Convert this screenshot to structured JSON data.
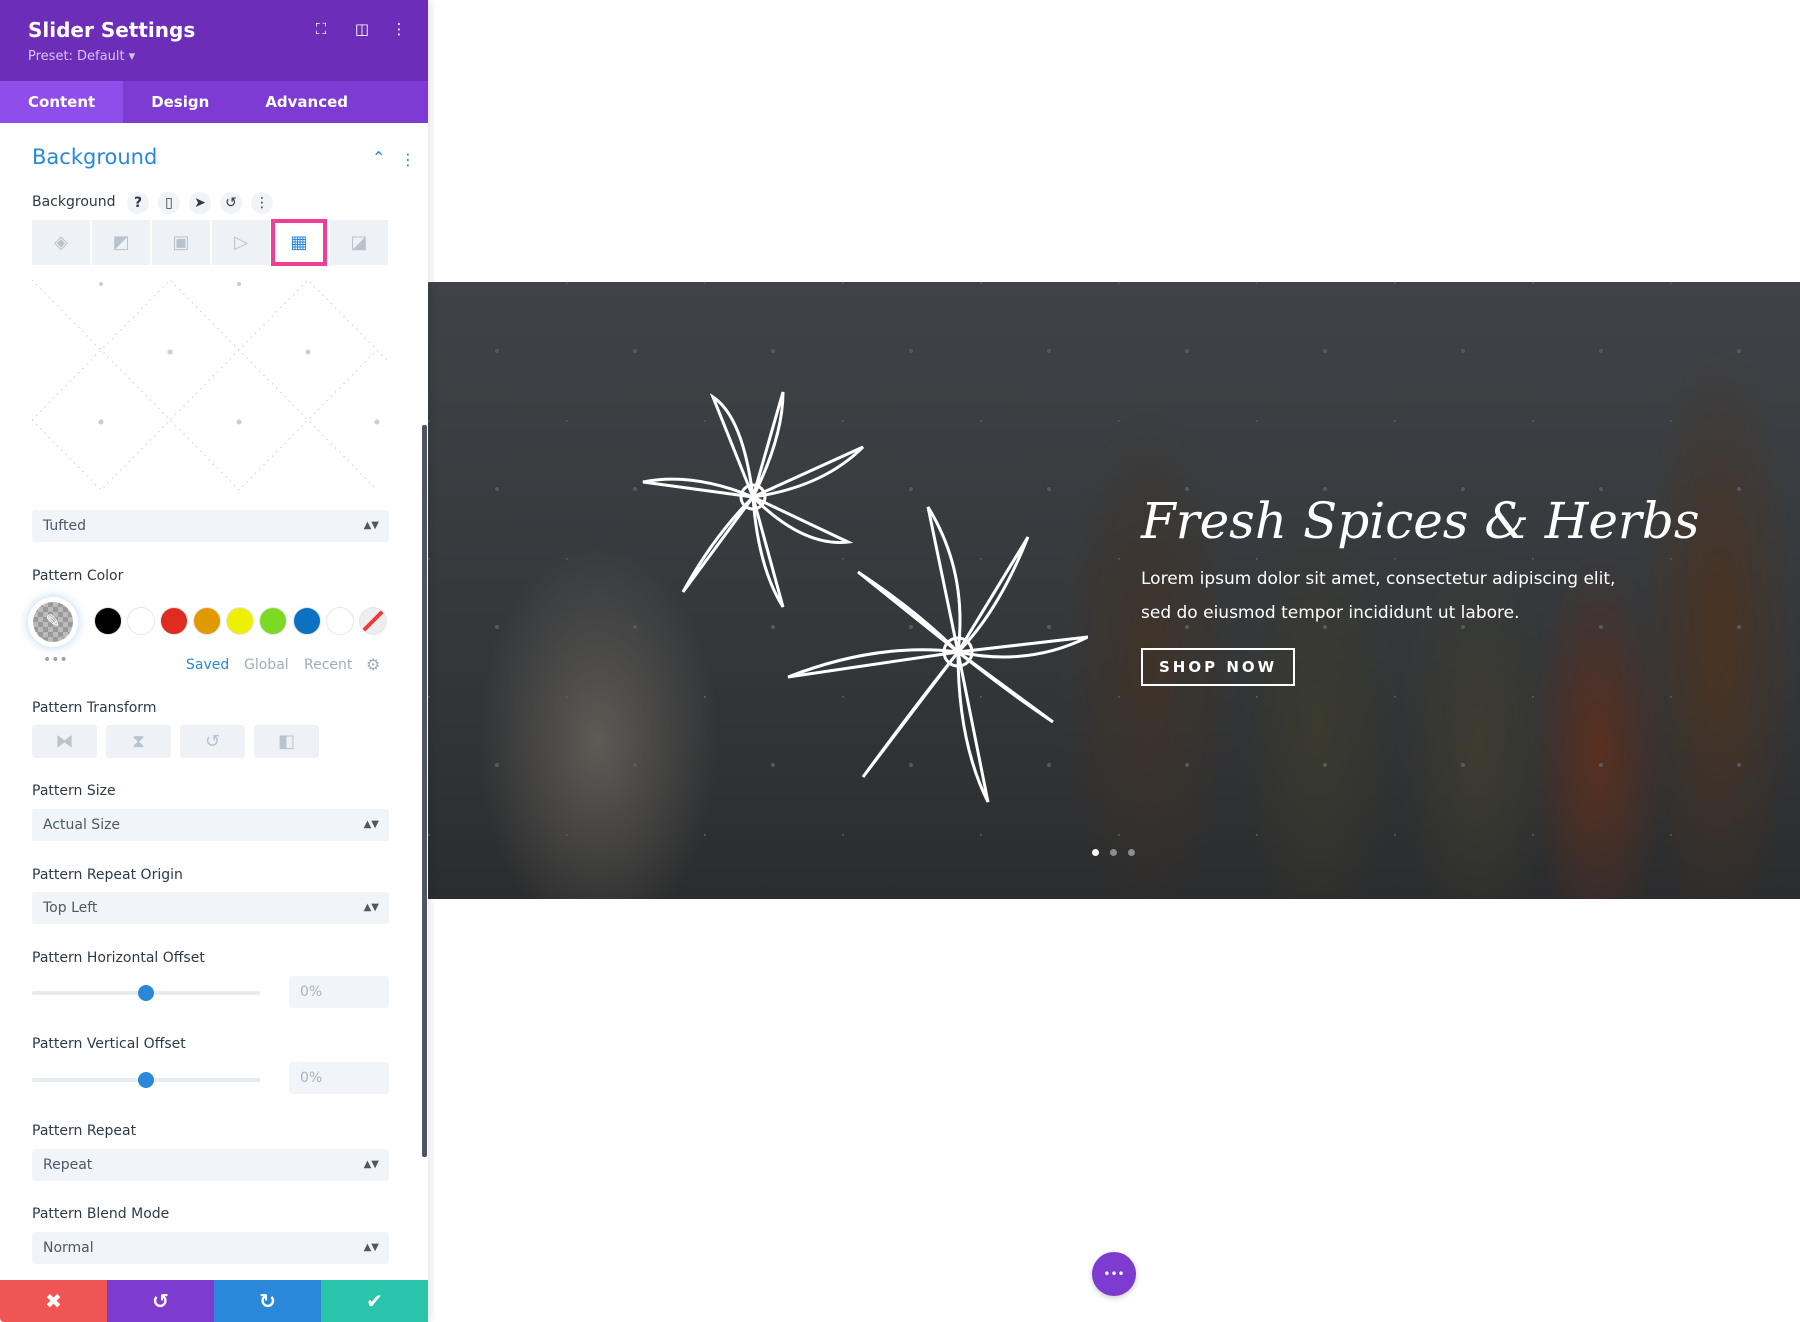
{
  "panel": {
    "title": "Slider Settings",
    "preset": "Preset: Default ▾",
    "header_icons": [
      "focus-icon",
      "split-view-icon",
      "more-vertical-icon"
    ],
    "tabs": [
      {
        "label": "Content",
        "active": true
      },
      {
        "label": "Design"
      },
      {
        "label": "Advanced"
      }
    ],
    "section_title": "Background",
    "background_label": "Background",
    "background_label_icons": [
      "help-icon",
      "mobile-icon",
      "hover-cursor-icon",
      "reset-icon",
      "more-vertical-icon"
    ],
    "background_types": [
      "color",
      "gradient",
      "image",
      "video",
      "pattern",
      "mask"
    ],
    "selected_background_type": "pattern",
    "pattern_select": "Tufted",
    "pattern_color_label": "Pattern Color",
    "swatches": [
      "#000000",
      "#ffffff",
      "#e02b20",
      "#e09900",
      "#edf000",
      "#7cda24",
      "#0c71c3",
      "#ffffff",
      "none"
    ],
    "color_tabs": {
      "saved": "Saved",
      "global": "Global",
      "recent": "Recent",
      "active": "Saved"
    },
    "pattern_transform_label": "Pattern Transform",
    "pattern_size_label": "Pattern Size",
    "pattern_size": "Actual Size",
    "repeat_origin_label": "Pattern Repeat Origin",
    "repeat_origin": "Top Left",
    "h_offset_label": "Pattern Horizontal Offset",
    "h_offset": "0%",
    "v_offset_label": "Pattern Vertical Offset",
    "v_offset": "0%",
    "repeat_label": "Pattern Repeat",
    "repeat": "Repeat",
    "blend_label": "Pattern Blend Mode",
    "blend": "Normal",
    "footer": {
      "cancel": "✖",
      "undo": "↺",
      "redo": "↻",
      "save": "✔"
    },
    "colors": {
      "header": "#6c2eb9",
      "accent": "#2b87da",
      "cancel": "#ef5555",
      "undo": "#7e3bd0",
      "redo": "#2b87da",
      "save": "#29c4a9",
      "highlight": "#ee3f92"
    }
  },
  "slide": {
    "title": "Fresh Spices & Herbs",
    "line1": "Lorem ipsum dolor sit amet, consectetur adipiscing elit,",
    "line2": "sed do eiusmod tempor incididunt ut labore.",
    "button": "SHOP NOW",
    "active_dot": 1,
    "dot_count": 3
  },
  "fab": "•••"
}
